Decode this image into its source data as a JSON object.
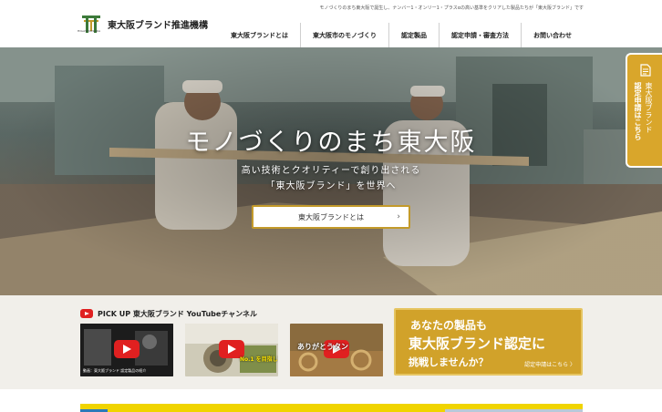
{
  "header": {
    "tagline": "モノづくりのまち東大阪で誕生し、ナンバー1・オンリー1・プラスαの高い基準をクリアした製品たちが「東大阪ブランド」です",
    "site_title": "東大阪ブランド推進機構",
    "logo_caption": "HIGASHIOSAKA",
    "logo_icon": "shrine-gate-logo"
  },
  "nav": {
    "items": [
      {
        "label": "東大阪ブランドとは"
      },
      {
        "label": "東大阪市のモノづくり"
      },
      {
        "label": "認定製品"
      },
      {
        "label": "認定申請・審査方法"
      },
      {
        "label": "お問い合わせ"
      }
    ]
  },
  "hero": {
    "title": "モノづくりのまち東大阪",
    "subtitle_line1": "高い技術とクオリティーで創り出される",
    "subtitle_line2": "「東大阪ブランド」を世界へ",
    "button_label": "東大阪ブランドとは",
    "button_icon": "chevron-right-icon"
  },
  "side_tab": {
    "line1": "東大阪ブランド",
    "line2": "認定申請はこちら",
    "icon": "document-icon"
  },
  "pickup": {
    "title": "PICK UP 東大阪ブランド YouTubeチャンネル",
    "icon": "youtube-icon",
    "videos": [
      {
        "caption": "動画：東大阪ブランド 認定製品の紹介",
        "overlay": ""
      },
      {
        "caption": "",
        "overlay": "No.1 を目指して"
      },
      {
        "caption": "",
        "overlay": "ありがとうタン"
      }
    ]
  },
  "cta": {
    "line1": "あなたの製品も",
    "line2": "東大阪ブランド認定に",
    "line3": "挑戦しませんか？",
    "link": "認定申請はこちら 〉"
  },
  "colors": {
    "brand_green": "#1f5a2e",
    "accent_gold": "#d1a22a",
    "youtube_red": "#e02020"
  }
}
